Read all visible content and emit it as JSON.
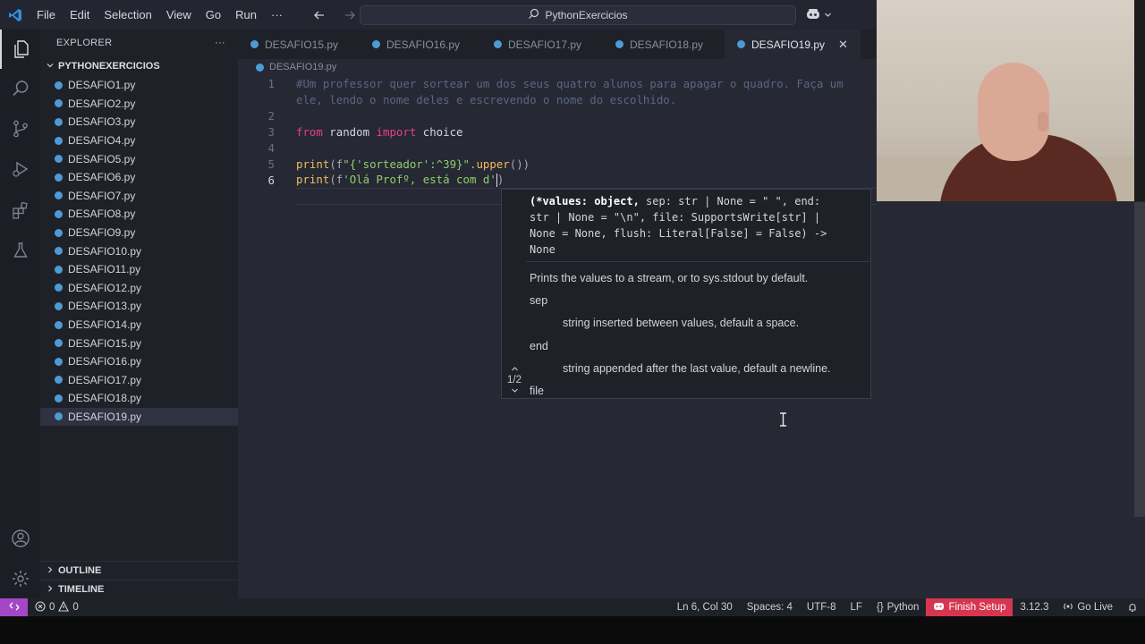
{
  "titlebar": {
    "menu": [
      "File",
      "Edit",
      "Selection",
      "View",
      "Go",
      "Run",
      "···"
    ],
    "search_text": "PythonExercicios"
  },
  "sidebar": {
    "title": "EXPLORER",
    "more": "···",
    "folder": "PYTHONEXERCICIOS",
    "files": [
      "DESAFIO1.py",
      "DESAFIO2.py",
      "DESAFIO3.py",
      "DESAFIO4.py",
      "DESAFIO5.py",
      "DESAFIO6.py",
      "DESAFIO7.py",
      "DESAFIO8.py",
      "DESAFIO9.py",
      "DESAFIO10.py",
      "DESAFIO11.py",
      "DESAFIO12.py",
      "DESAFIO13.py",
      "DESAFIO14.py",
      "DESAFIO15.py",
      "DESAFIO16.py",
      "DESAFIO17.py",
      "DESAFIO18.py",
      "DESAFIO19.py"
    ],
    "selected_file": "DESAFIO19.py",
    "outline": "OUTLINE",
    "timeline": "TIMELINE"
  },
  "tabs": [
    {
      "label": "DESAFIO15.py"
    },
    {
      "label": "DESAFIO16.py"
    },
    {
      "label": "DESAFIO17.py"
    },
    {
      "label": "DESAFIO18.py"
    },
    {
      "label": "DESAFIO19.py",
      "active": true
    }
  ],
  "breadcrumb": "DESAFIO19.py",
  "code": {
    "line_numbers": [
      "1",
      "2",
      "3",
      "4",
      "5",
      "6"
    ],
    "l1a": "#Um professor quer sortear um dos seus quatro alunos para apagar o quadro. Faça um",
    "l1b": "ele, lendo o nome deles e escrevendo o nome do escolhido.",
    "l3_from": "from",
    "l3_mod": " random ",
    "l3_import": "import",
    "l3_name": " choice",
    "l5_print": "print",
    "l5_open": "(f",
    "l5_str": "\"{'sorteador':^39}\"",
    "l5_dot": ".",
    "l5_upper": "upper",
    "l5_close": "())",
    "l6_print": "print",
    "l6_open": "(f",
    "l6_str": "'Olá Profº, está com d'",
    "l6_close": ")"
  },
  "signature": {
    "params_bold": "(*values: object,",
    "params_rest_1": " sep: str | None = \" \", end:",
    "line2": "str | None = \"\\n\", file: SupportsWrite[str] |",
    "line3": "None = None, flush: Literal[False] = False) ->",
    "line4": "None",
    "doc": "Prints the values to a stream, or to sys.stdout by default.",
    "sep": "sep",
    "sep_desc": "string inserted between values, default a space.",
    "end": "end",
    "end_desc": "string appended after the last value, default a newline.",
    "file": "file",
    "counter": "1/2"
  },
  "status": {
    "errors": "0",
    "warnings": "0",
    "position": "Ln 6, Col 30",
    "spaces": "Spaces: 4",
    "encoding": "UTF-8",
    "eol": "LF",
    "language": "Python",
    "finish_setup": "Finish Setup",
    "version": "3.12.3",
    "go_live": "Go Live"
  },
  "colors": {
    "accent_remote": "#a347c7",
    "finish_setup_bg": "#d6364f",
    "keyword": "#e83e8c",
    "function": "#f0bd5c",
    "string": "#8fcf6a",
    "comment": "#5a6683"
  }
}
